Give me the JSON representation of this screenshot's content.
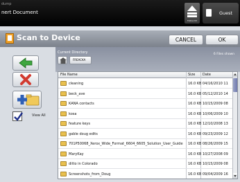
{
  "window": {
    "subtitle": "dump",
    "title": "nert Document"
  },
  "device": {
    "label": "FREACHH"
  },
  "user": {
    "label": "Guest"
  },
  "header": {
    "title": "Scan to Device",
    "cancel_label": "CANCEL",
    "ok_label": "OK"
  },
  "left": {
    "view_all_label": "View All",
    "view_all_checked": true
  },
  "directory": {
    "label": "Current Directory",
    "current": "FREACKA",
    "files_shown": "6 Files shown"
  },
  "table": {
    "columns": [
      "File Name",
      "Size",
      "Date"
    ],
    "rows": [
      {
        "name": "cleaning",
        "size": "16.0 KB",
        "date": "04/16/2010 11"
      },
      {
        "name": "beck_ave",
        "size": "16.0 KB",
        "date": "05/12/2010 14"
      },
      {
        "name": "KANA contacts",
        "size": "16.0 KB",
        "date": "10/15/2009 08"
      },
      {
        "name": "kosa",
        "size": "16.0 KB",
        "date": "10/06/2009 10"
      },
      {
        "name": "feature keys",
        "size": "16.0 KB",
        "date": "12/10/2008 13"
      },
      {
        "name": "gable doug edits",
        "size": "16.0 KB",
        "date": "09/23/2009 12"
      },
      {
        "name": "701P50068_Xerox_Wide_Format_6604_6605_Solution_User_Guide",
        "size": "16.0 KB",
        "date": "08/26/2009 15"
      },
      {
        "name": "MaryKay",
        "size": "16.0 KB",
        "date": "10/27/2008 09"
      },
      {
        "name": "ditto in Colorado",
        "size": "16.0 KB",
        "date": "10/15/2009 08"
      },
      {
        "name": "Screenshots_from_Doug",
        "size": "16.0 KB",
        "date": "09/04/2009 16"
      }
    ]
  },
  "colors": {
    "topbar": "#000000",
    "header": "#8e949d",
    "accent_green": "#3fa63f",
    "accent_red": "#d23a2f",
    "accent_blue": "#2f5fb5"
  }
}
